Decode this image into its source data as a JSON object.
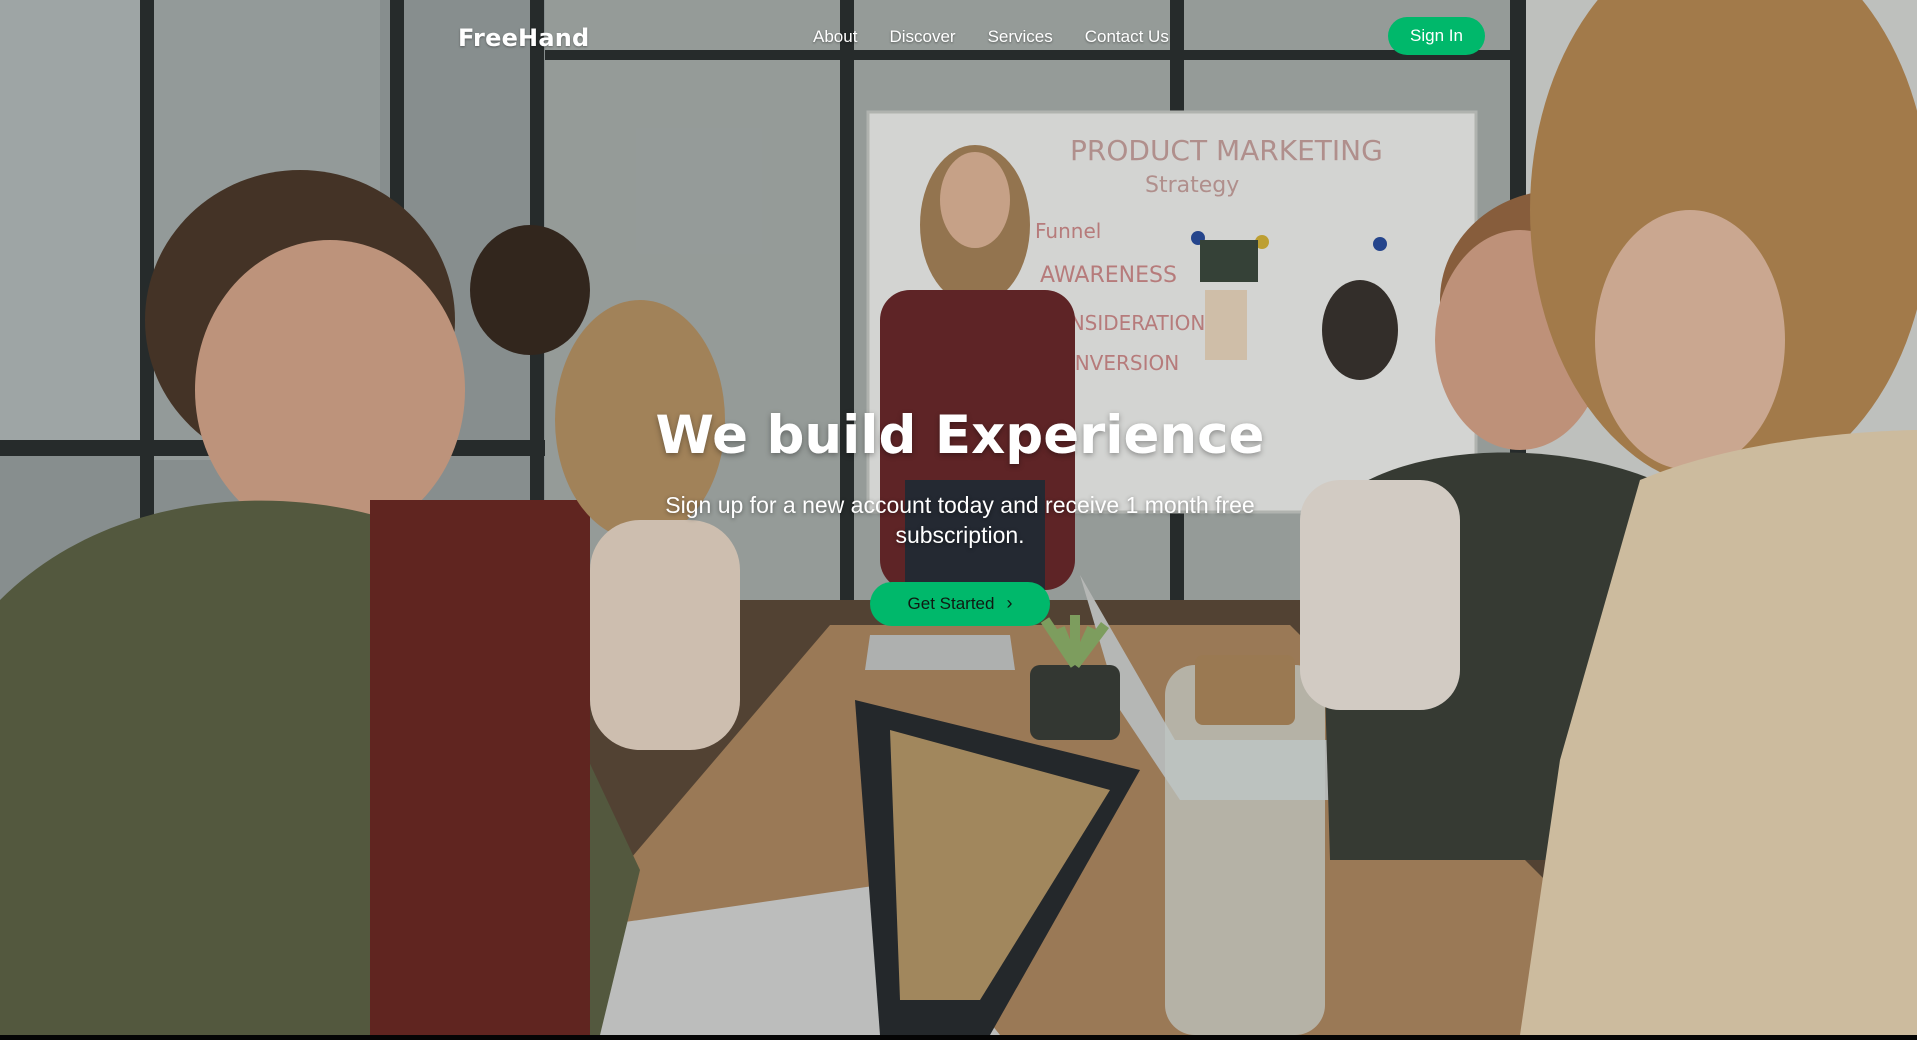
{
  "brand": {
    "name": "FreeHand"
  },
  "nav": {
    "links": [
      {
        "label": "About"
      },
      {
        "label": "Discover"
      },
      {
        "label": "Services"
      },
      {
        "label": "Contact Us"
      }
    ],
    "signin_label": "Sign In"
  },
  "hero": {
    "title": "We build Experience",
    "subtitle": "Sign up for a new account today and receive 1 month free subscription.",
    "cta_label": "Get Started",
    "cta_icon": "chevron-right-icon",
    "background_image": "meeting-room-photo",
    "whiteboard": {
      "heading": "PRODUCT MARKETING",
      "subheading": "Strategy",
      "lines": [
        "Funnel",
        "AWARENESS",
        "CONSIDERATION",
        "CONVERSION"
      ]
    }
  },
  "colors": {
    "accent": "#00b86b",
    "text_on_hero": "#ffffff"
  }
}
